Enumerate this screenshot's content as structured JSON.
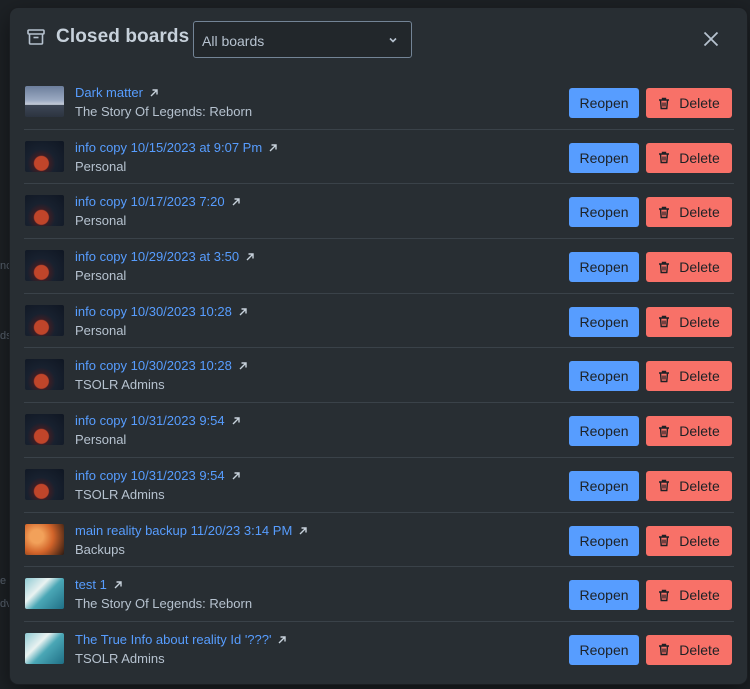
{
  "dialog": {
    "title": "Closed boards",
    "filter_value": "All boards"
  },
  "rows": [
    {
      "name": "Dark matter",
      "workspace": "The Story Of Legends: Reborn",
      "thumbnail": "city-skyline"
    },
    {
      "name": "info copy 10/15/2023 at 9:07 Pm",
      "workspace": "Personal",
      "thumbnail": "space-planet"
    },
    {
      "name": "info copy 10/17/2023 7:20",
      "workspace": "Personal",
      "thumbnail": "space-planet"
    },
    {
      "name": "info copy 10/29/2023 at 3:50",
      "workspace": "Personal",
      "thumbnail": "space-planet"
    },
    {
      "name": "info copy 10/30/2023 10:28",
      "workspace": "Personal",
      "thumbnail": "space-planet"
    },
    {
      "name": "info copy 10/30/2023 10:28",
      "workspace": "TSOLR Admins",
      "thumbnail": "space-planet"
    },
    {
      "name": "info copy 10/31/2023 9:54",
      "workspace": "Personal",
      "thumbnail": "space-planet"
    },
    {
      "name": "info copy 10/31/2023 9:54",
      "workspace": "TSOLR Admins",
      "thumbnail": "space-planet"
    },
    {
      "name": "main reality backup 11/20/23 3:14 PM",
      "workspace": "Backups",
      "thumbnail": "orange-leaf"
    },
    {
      "name": "test 1",
      "workspace": "The Story Of Legends: Reborn",
      "thumbnail": "ocean-waves"
    },
    {
      "name": "The True Info about reality Id '???'",
      "workspace": "TSOLR Admins",
      "thumbnail": "ocean-waves"
    }
  ],
  "actions": {
    "reopen_label": "Reopen",
    "delete_label": "Delete"
  },
  "colors": {
    "link": "#579dff",
    "reopen": "#579dff",
    "delete": "#f87168",
    "dialog_bg": "#282e33"
  }
}
